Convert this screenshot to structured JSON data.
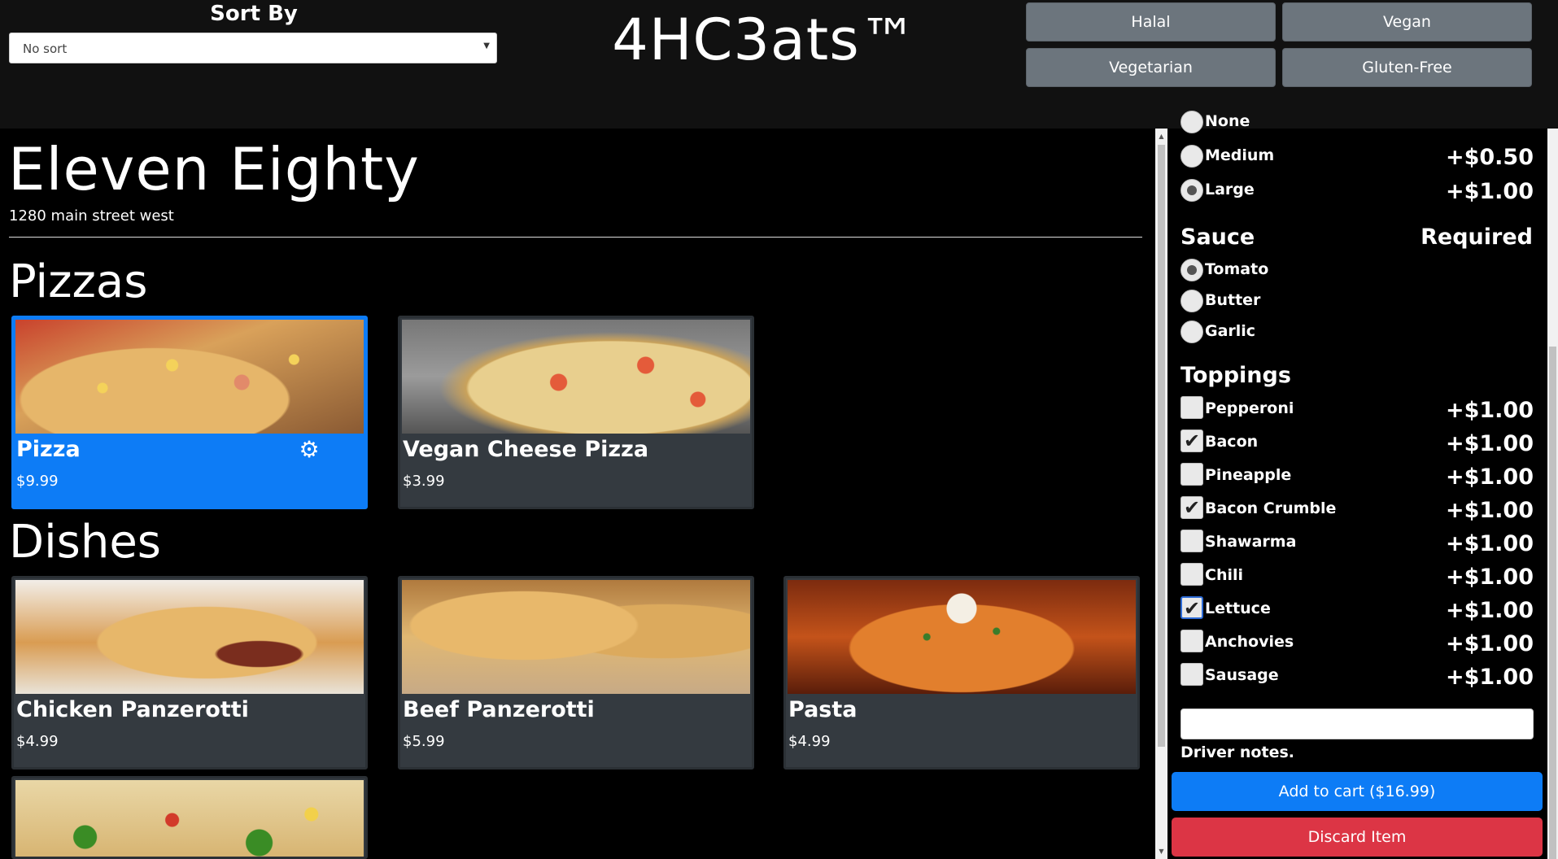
{
  "header": {
    "sort_title": "Sort By",
    "sort_value": "No sort",
    "brand": "4HC3ats™",
    "filters": [
      "Halal",
      "Vegan",
      "Vegetarian",
      "Gluten-Free"
    ]
  },
  "restaurant": {
    "name": "Eleven Eighty",
    "address": "1280 main street west"
  },
  "sections": {
    "pizzas": {
      "title": "Pizzas",
      "items": [
        {
          "name": "Pizza",
          "price": "$9.99",
          "selected": true,
          "icon": "gear-icon"
        },
        {
          "name": "Vegan Cheese Pizza",
          "price": "$3.99"
        }
      ]
    },
    "dishes": {
      "title": "Dishes",
      "items": [
        {
          "name": "Chicken Panzerotti",
          "price": "$4.99"
        },
        {
          "name": "Beef Panzerotti",
          "price": "$5.99"
        },
        {
          "name": "Pasta",
          "price": "$4.99"
        },
        {
          "name": "",
          "price": ""
        }
      ]
    }
  },
  "options": {
    "size": {
      "partial_label": "None",
      "items": [
        {
          "label": "Medium",
          "price": "+$0.50",
          "checked": false
        },
        {
          "label": "Large",
          "price": "+$1.00",
          "checked": true
        }
      ]
    },
    "sauce": {
      "title": "Sauce",
      "required": "Required",
      "items": [
        {
          "label": "Tomato",
          "checked": true
        },
        {
          "label": "Butter",
          "checked": false
        },
        {
          "label": "Garlic",
          "checked": false
        }
      ]
    },
    "toppings": {
      "title": "Toppings",
      "items": [
        {
          "label": "Pepperoni",
          "price": "+$1.00",
          "checked": false
        },
        {
          "label": "Bacon",
          "price": "+$1.00",
          "checked": true
        },
        {
          "label": "Pineapple",
          "price": "+$1.00",
          "checked": false
        },
        {
          "label": "Bacon Crumble",
          "price": "+$1.00",
          "checked": true
        },
        {
          "label": "Shawarma",
          "price": "+$1.00",
          "checked": false
        },
        {
          "label": "Chili",
          "price": "+$1.00",
          "checked": false
        },
        {
          "label": "Lettuce",
          "price": "+$1.00",
          "checked": true
        },
        {
          "label": "Anchovies",
          "price": "+$1.00",
          "checked": false
        },
        {
          "label": "Sausage",
          "price": "+$1.00",
          "checked": false
        }
      ]
    },
    "notes_label": "Driver notes.",
    "notes_value": "",
    "add_to_cart": "Add to cart ($16.99)",
    "discard": "Discard Item"
  },
  "colors": {
    "accent_blue": "#0d7cf6",
    "danger_red": "#dc3545",
    "filter_gray": "#6c757d",
    "card_gray": "#343a40"
  }
}
